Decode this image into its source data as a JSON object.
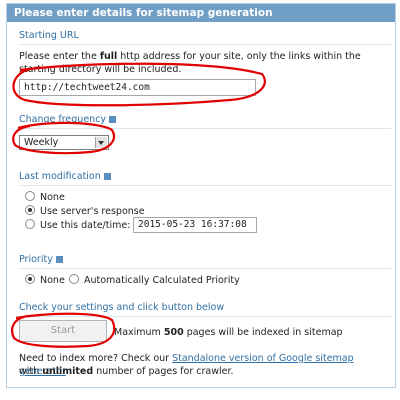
{
  "header": "Please enter details for sitemap generation",
  "starting_url": {
    "title": "Starting URL",
    "desc_pre": "Please enter the ",
    "desc_bold": "full",
    "desc_post": " http address for your site, only the links within the starting directory will be included.",
    "value": "http://techtweet24.com"
  },
  "change_frequency": {
    "title": "Change frequency",
    "selected": "Weekly"
  },
  "last_modification": {
    "title": "Last modification",
    "options": [
      "None",
      "Use server's response",
      "Use this date/time:"
    ],
    "selected_index": 1,
    "datetime_value": "2015-05-23 16:37:08"
  },
  "priority": {
    "title": "Priority",
    "options": [
      "None",
      "Automatically Calculated Priority"
    ],
    "selected_index": 0
  },
  "submit": {
    "title": "Check your settings and click button below",
    "button": "Start",
    "note_pre": "Maximum ",
    "note_bold": "500",
    "note_post": " pages will be indexed in sitemap"
  },
  "footer": {
    "line1_pre": "Need to index more? Check our ",
    "link": "Standalone version of Google sitemap generator",
    "line2_pre": "with ",
    "line2_bold": "unlimited",
    "line2_post": " number of pages for crawler."
  },
  "colors": {
    "header_bg": "#6f9fc6",
    "section_title": "#2f6fa3",
    "annotation": "#e00000"
  }
}
